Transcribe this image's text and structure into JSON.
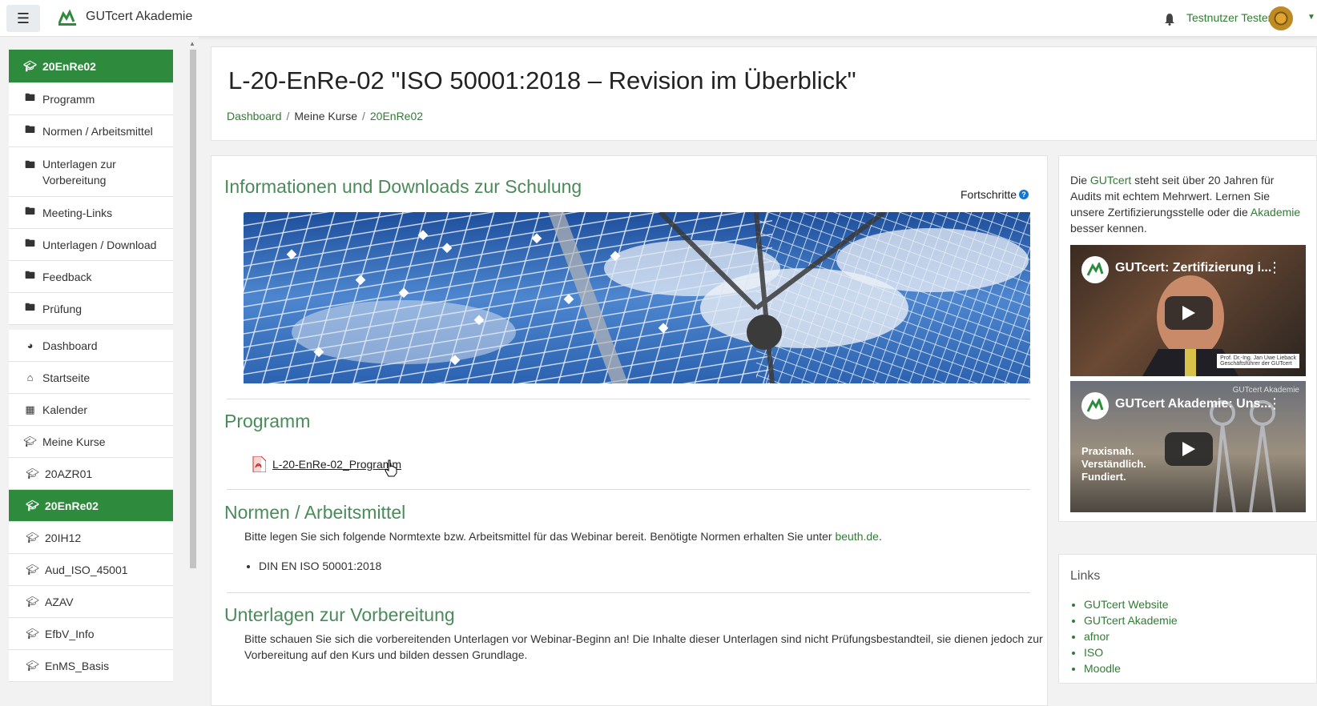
{
  "navbar": {
    "menu_icon": "hamburger-icon",
    "brand_name": "GUTcert Akademie",
    "notification_icon": "bell-icon",
    "user_name": "Testnutzer Testen"
  },
  "sidebar": {
    "course_header": "20EnRe02",
    "sections": [
      {
        "label": "Programm",
        "icon": "folder-icon"
      },
      {
        "label": "Normen / Arbeitsmittel",
        "icon": "folder-icon"
      },
      {
        "label": "Unterlagen zur Vorbereitung",
        "icon": "folder-icon"
      },
      {
        "label": "Meeting-Links",
        "icon": "folder-icon"
      },
      {
        "label": "Unterlagen / Download",
        "icon": "folder-icon"
      },
      {
        "label": "Feedback",
        "icon": "folder-icon"
      },
      {
        "label": "Prüfung",
        "icon": "folder-icon"
      }
    ],
    "nav": [
      {
        "label": "Dashboard",
        "icon": "dashboard-icon"
      },
      {
        "label": "Startseite",
        "icon": "home-icon"
      },
      {
        "label": "Kalender",
        "icon": "calendar-icon"
      },
      {
        "label": "Meine Kurse",
        "icon": "graduation-cap-icon"
      }
    ],
    "courses": [
      {
        "label": "20AZR01",
        "active": false
      },
      {
        "label": "20EnRe02",
        "active": true
      },
      {
        "label": "20IH12",
        "active": false
      },
      {
        "label": "Aud_ISO_45001",
        "active": false
      },
      {
        "label": "AZAV",
        "active": false
      },
      {
        "label": "EfbV_Info",
        "active": false
      },
      {
        "label": "EnMS_Basis",
        "active": false
      }
    ]
  },
  "header": {
    "title": "L-20-EnRe-02 \"ISO 50001:2018 – Revision im Überblick\"",
    "breadcrumb": [
      "Dashboard",
      "Meine Kurse",
      "20EnRe02"
    ]
  },
  "main": {
    "info_title": "Informationen und Downloads zur Schulung",
    "progress_label": "Fortschritte",
    "programm_title": "Programm",
    "programm_file": "L-20-EnRe-02_Programm",
    "normen_title": "Normen / Arbeitsmittel",
    "normen_text": "Bitte legen Sie sich folgende Normtexte bzw. Arbeitsmittel für das Webinar bereit. Benötigte Normen erhalten Sie unter ",
    "normen_link": "beuth.de",
    "normen_list": [
      "DIN EN ISO 50001:2018"
    ],
    "unterlagen_title": "Unterlagen zur Vorbereitung",
    "unterlagen_text_1": "Bitte schauen Sie sich die vorbereitenden Unterlagen vor Webinar-Beginn an! Die Inhalte dieser Unterlagen sind nicht Prüfungsbestandteil, sie dienen jedoch zur",
    "unterlagen_text_2": "Vorbereitung auf den Kurs und bilden dessen Grundlage."
  },
  "right": {
    "text_1": "Die ",
    "link_1": "GUTcert",
    "text_2": " steht seit über 20 Jahren für Audits mit echtem Mehrwert. Lernen Sie unsere Zertifizierungsstelle oder die ",
    "link_2": "Akademie",
    "text_3": " besser kennen.",
    "video_1": {
      "title": "GUTcert: Zertifizierung i...",
      "caption_1": "Prof. Dr.-Ing. Jan Uwe Lieback",
      "caption_2": "Geschäftsführer der GUTcert"
    },
    "video_2": {
      "title": "GUTcert Akademie: Uns...",
      "overlay_1": "Praxisnah.",
      "overlay_2": "Verständlich.",
      "overlay_3": "Fundiert.",
      "watermark": "GUTcert Akademie"
    },
    "links_title": "Links",
    "links": [
      "GUTcert Website",
      "GUTcert Akademie",
      "afnor",
      "ISO",
      "Moodle"
    ]
  },
  "colors": {
    "brand_green": "#2e8b3d",
    "link_green": "#2f7d32",
    "section_title": "#4b8a5a"
  }
}
